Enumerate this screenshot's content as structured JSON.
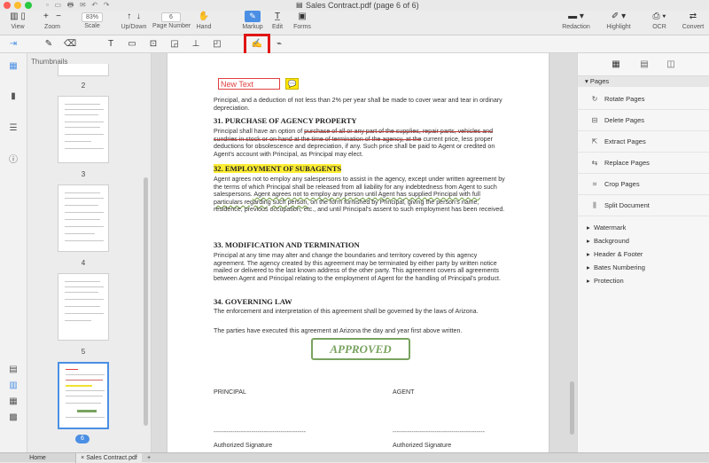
{
  "window": {
    "title": "Sales Contract.pdf (page 6 of 6)"
  },
  "toolbar": {
    "view_label": "View",
    "zoom_label": "Zoom",
    "zoom_plus": "+",
    "zoom_minus": "−",
    "scale_value": "83%",
    "scale_label": "Scale",
    "up_down_label": "Up/Down",
    "page_number_value": "6",
    "page_number_label": "Page Number",
    "hand_label": "Hand",
    "markup_label": "Markup",
    "edit_label": "Edit",
    "forms_label": "Forms",
    "redaction_label": "Redaction",
    "highlight_label": "Highlight",
    "ocr_label": "OCR",
    "convert_label": "Convert"
  },
  "thumbs": {
    "header": "Thumbnails",
    "pages": [
      "2",
      "3",
      "4",
      "5"
    ],
    "selected": "6"
  },
  "doc": {
    "new_text": "New Text",
    "intro": "Principal, and a deduction of not less than 2% per year shall be made to cover wear and tear in ordinary depreciation.",
    "h31": "31.   PURCHASE OF AGENCY PROPERTY",
    "p31_a": "Principal shall have an option of ",
    "p31_strike": "purchase of all or any part of the supplies, repair parts, vehicles and sundries in stock or on hand at the time of termination of the agency, at the",
    "p31_b": " current price, less proper deductions for obsolescence and depreciation, if any. Such price shall be paid to Agent or credited on Agent's account with Principal, as Principal may elect.",
    "h32": "32.   EMPLOYMENT OF SUBAGENTS",
    "p32_a": "Agent agrees not to employ any salespersons to assist in the agency, except under written agreement by the terms of which Principal shall be released from all liability for any indebtedness from Agent to such salespersons.",
    "p32_wave": " Agent agrees not to employ any person until Agent has supplied Principal with full particulars regarding such person,",
    "p32_b": " on the form furnished by Principal, giving the person's name, residence, previous occupation, etc., and until Principal's assent to such employment has been received.",
    "h33": "33.   MODIFICATION AND TERMINATION",
    "p33": "Principal at any time may alter and change the boundaries and territory covered by this agency agreement. The agency created by this agreement may be terminated by either party by written notice mailed or delivered to the last known address of the other party. This agreement covers all agreements between Agent and Principal relating to the employment of Agent for the handling of Principal's product.",
    "h34": "34.   GOVERNING LAW",
    "p34": "The enforcement and interpretation of this agreement shall be governed by the laws of Arizona.",
    "p_exec": "The parties have executed this agreement at Arizona the day and year first above written.",
    "stamp": "APPROVED",
    "principal": "PRINCIPAL",
    "agent": "AGENT",
    "dashes": "--------------------------------------------",
    "sig1": "Authorized Signature",
    "sig2": "Authorized Signature"
  },
  "rail": {
    "pages_header": "Pages",
    "actions": [
      "Rotate Pages",
      "Delete Pages",
      "Extract Pages",
      "Replace Pages",
      "Crop Pages",
      "Split Document"
    ],
    "sections": [
      "Watermark",
      "Background",
      "Header & Footer",
      "Bates Numbering",
      "Protection"
    ]
  },
  "tabs": {
    "home": "Home",
    "doc": "Sales Contract.pdf",
    "plus": "+"
  },
  "colors": {
    "accent": "#4a8fe4",
    "highlight": "#ffee33",
    "stamp": "#79a35f",
    "callout": "#e01515"
  }
}
